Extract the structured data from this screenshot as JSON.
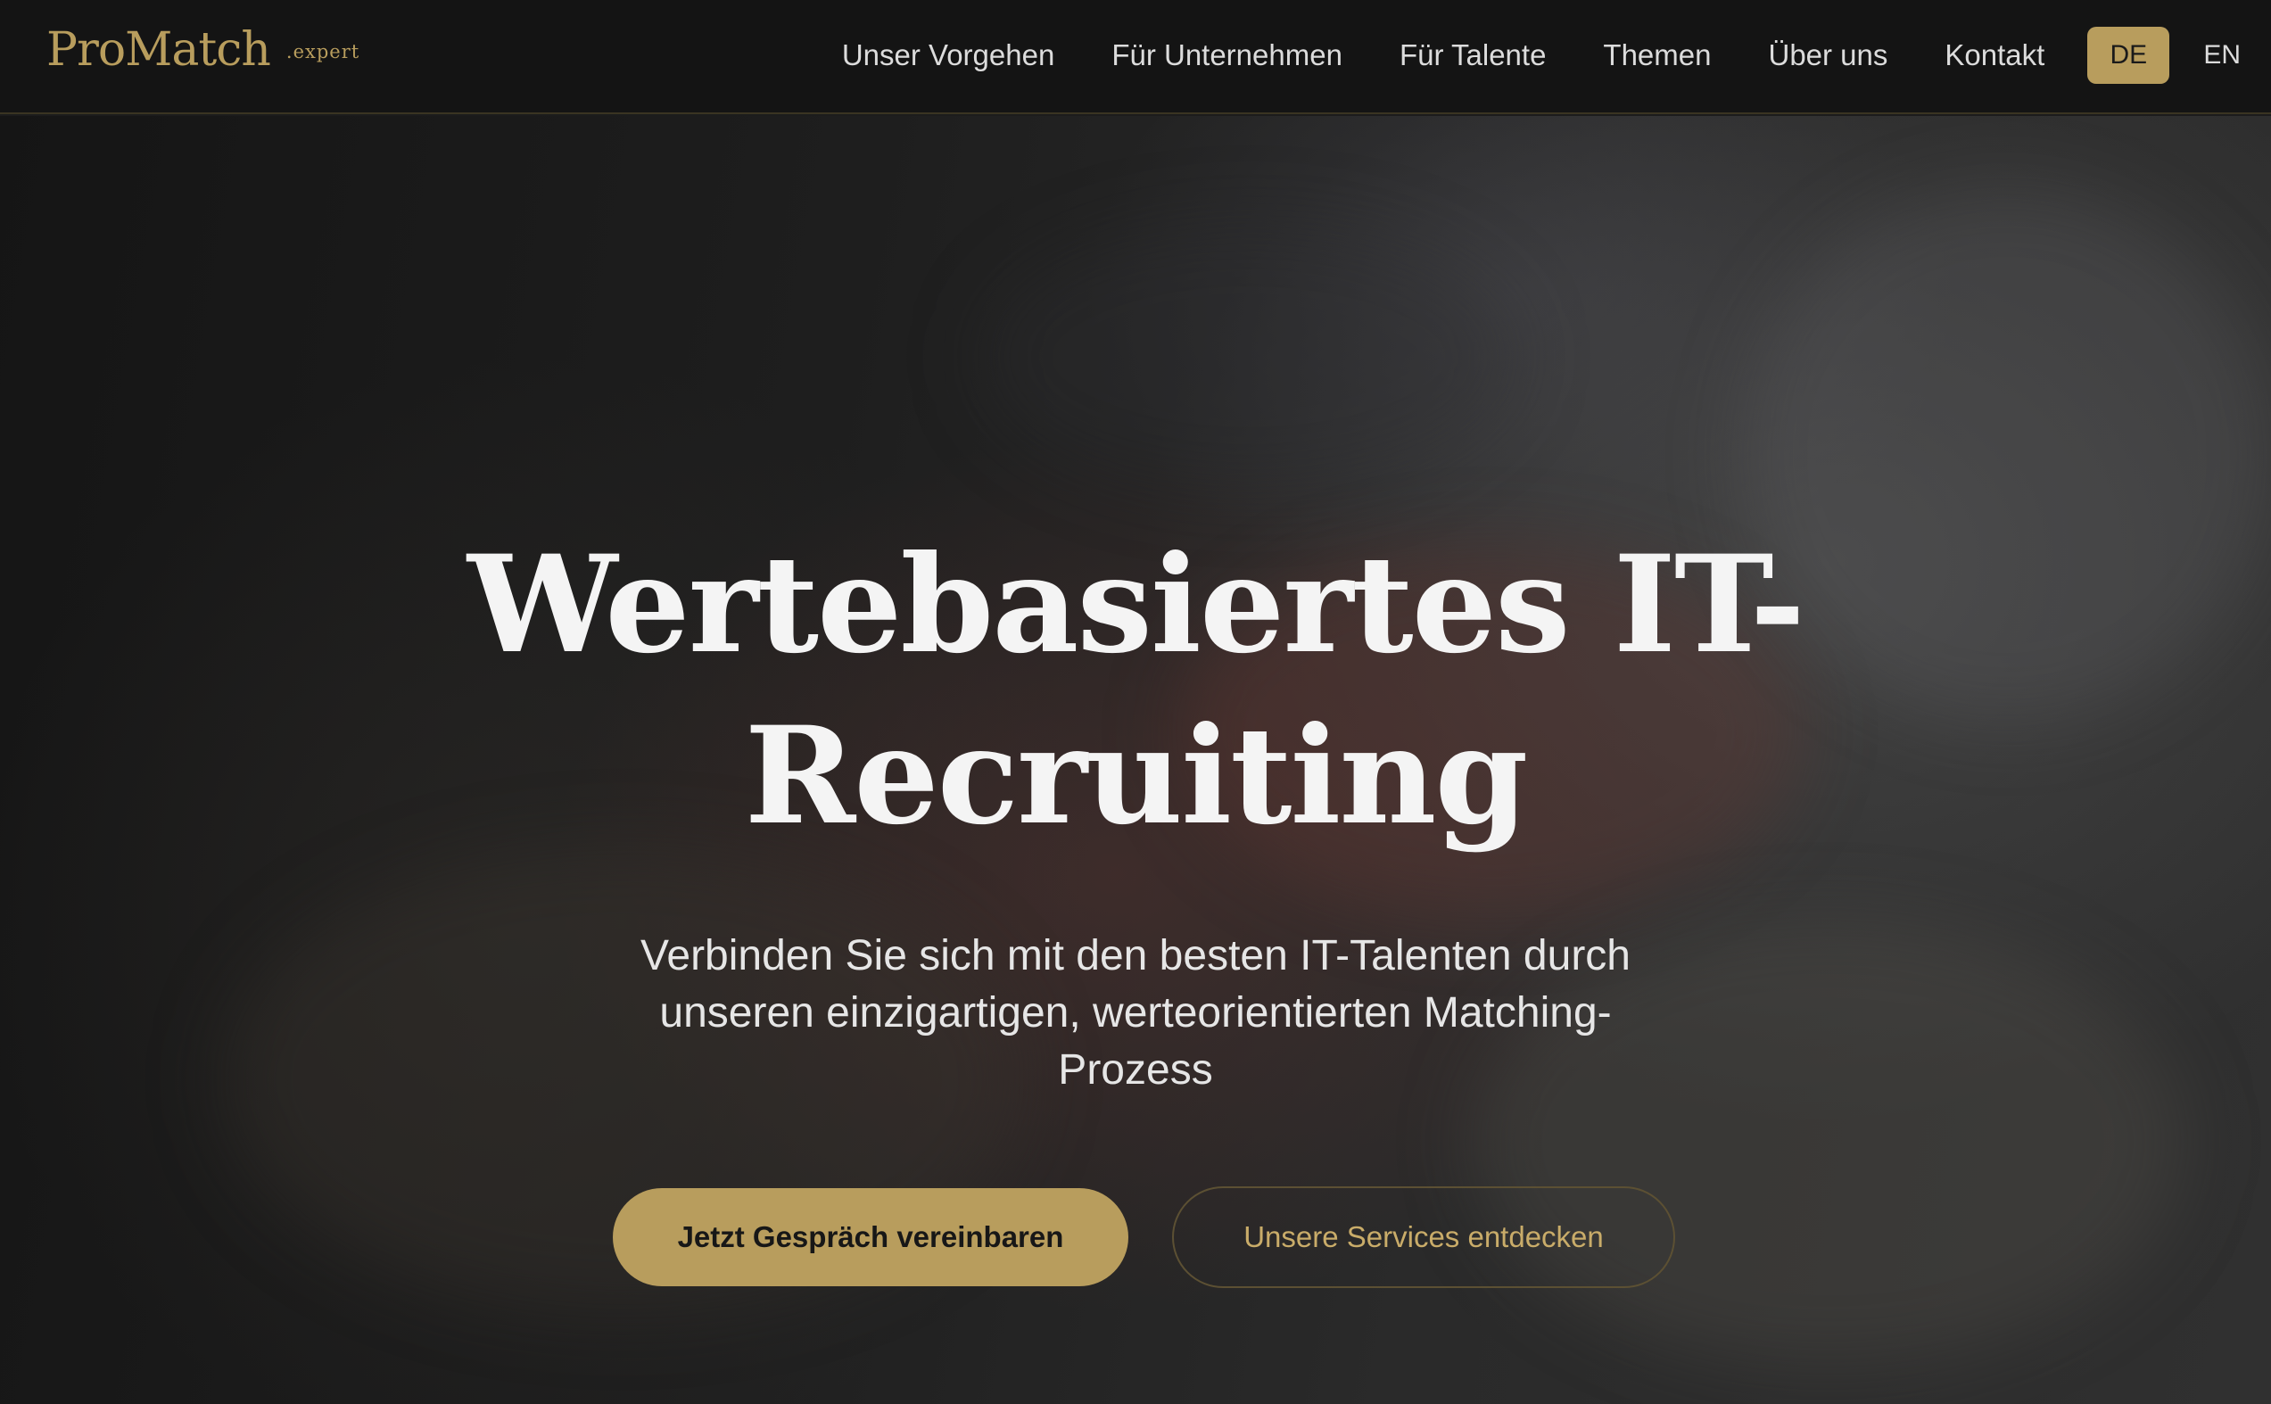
{
  "header": {
    "logo": {
      "name": "ProMatch",
      "suffix": ".expert"
    },
    "nav": [
      {
        "label": "Unser Vorgehen"
      },
      {
        "label": "Für Unternehmen"
      },
      {
        "label": "Für Talente"
      },
      {
        "label": "Themen"
      },
      {
        "label": "Über uns"
      },
      {
        "label": "Kontakt"
      }
    ],
    "languages": {
      "active": "DE",
      "other": "EN"
    }
  },
  "hero": {
    "title_line1": "Wertebasiertes IT-",
    "title_line2": "Recruiting",
    "subtitle_line1": "Verbinden Sie sich mit den besten IT-Talenten durch",
    "subtitle_line2": "unseren einzigartigen, werteorientierten Matching-",
    "subtitle_line3": "Prozess",
    "primary_cta": "Jetzt Gespräch vereinbaren",
    "secondary_cta": "Unsere Services entdecken"
  },
  "colors": {
    "accent_gold": "#b89d5d",
    "header_bg": "#141414",
    "text_light": "#f4f4f4"
  }
}
